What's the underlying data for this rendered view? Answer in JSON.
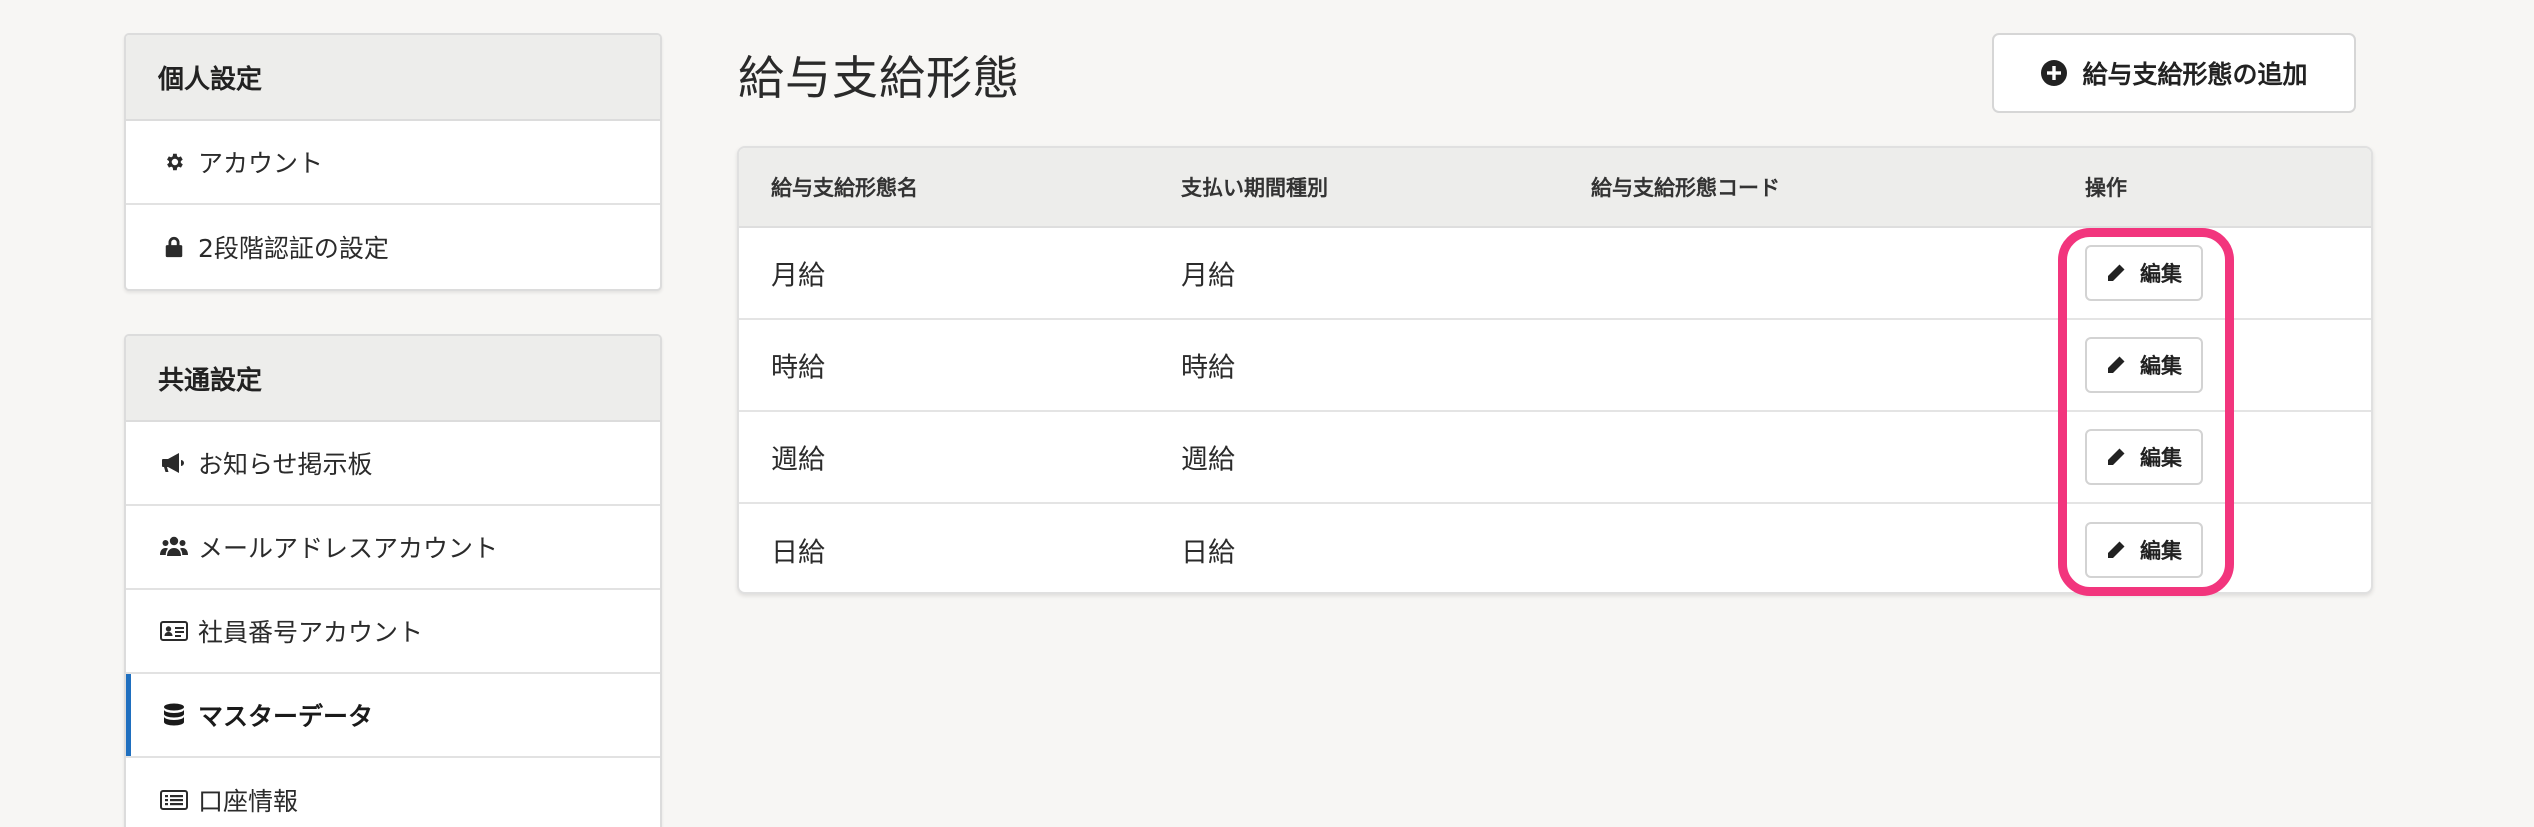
{
  "sidebar": {
    "personal": {
      "title": "個人設定",
      "items": [
        {
          "label": "アカウント",
          "icon": "gear-icon"
        },
        {
          "label": "2段階認証の設定",
          "icon": "lock-icon"
        }
      ]
    },
    "common": {
      "title": "共通設定",
      "items": [
        {
          "label": "お知らせ掲示板",
          "icon": "megaphone-icon"
        },
        {
          "label": "メールアドレスアカウント",
          "icon": "users-icon"
        },
        {
          "label": "社員番号アカウント",
          "icon": "id-card-icon"
        },
        {
          "label": "マスターデータ",
          "icon": "database-icon",
          "active": true
        },
        {
          "label": "口座情報",
          "icon": "list-card-icon"
        }
      ]
    }
  },
  "main": {
    "title": "給与支給形態",
    "add_button_label": "給与支給形態の追加",
    "table": {
      "columns": [
        "給与支給形態名",
        "支払い期間種別",
        "給与支給形態コード",
        "操作"
      ],
      "rows": [
        {
          "name": "月給",
          "period": "月給",
          "code": "",
          "action": "編集"
        },
        {
          "name": "時給",
          "period": "時給",
          "code": "",
          "action": "編集"
        },
        {
          "name": "週給",
          "period": "週給",
          "code": "",
          "action": "編集"
        },
        {
          "name": "日給",
          "period": "日給",
          "code": "",
          "action": "編集"
        }
      ]
    }
  },
  "colors": {
    "background": "#f7f6f4",
    "active_indicator": "#1f6fbf",
    "highlight": "#f2357d"
  }
}
